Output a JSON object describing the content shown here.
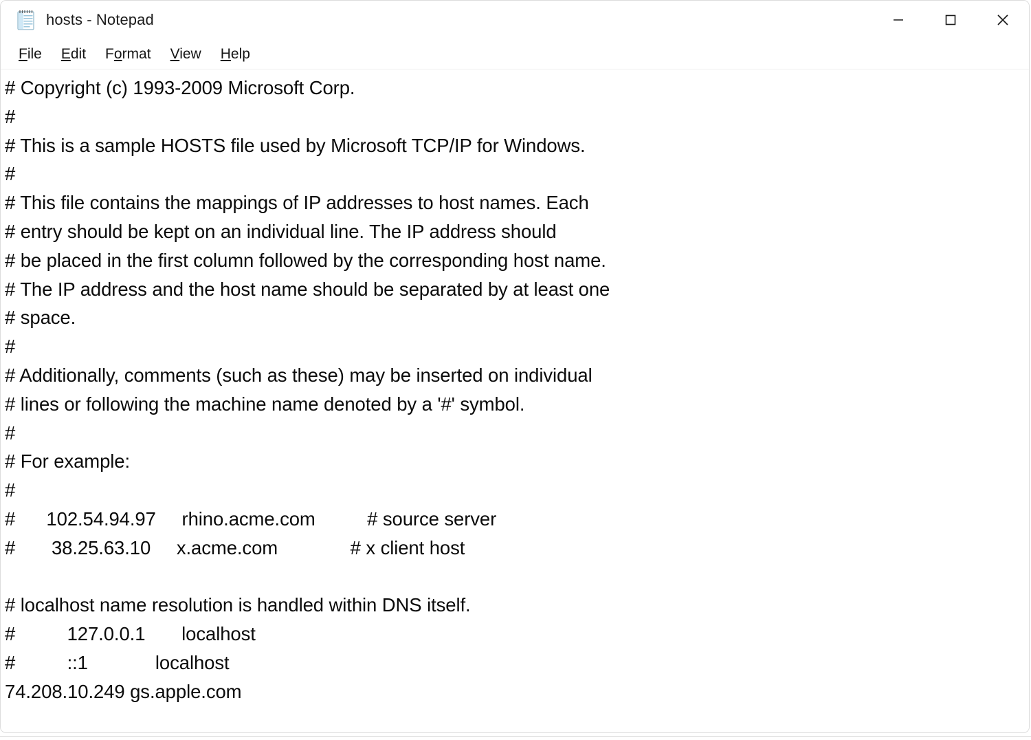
{
  "window": {
    "title": "hosts - Notepad",
    "icon": "notepad-icon",
    "controls": {
      "minimize": "minimize-icon",
      "maximize": "maximize-icon",
      "close": "close-icon"
    }
  },
  "menubar": {
    "items": [
      {
        "label": "File",
        "access_before": "",
        "access_key": "F",
        "access_after": "ile"
      },
      {
        "label": "Edit",
        "access_before": "",
        "access_key": "E",
        "access_after": "dit"
      },
      {
        "label": "Format",
        "access_before": "F",
        "access_key": "o",
        "access_after": "rmat"
      },
      {
        "label": "View",
        "access_before": "",
        "access_key": "V",
        "access_after": "iew"
      },
      {
        "label": "Help",
        "access_before": "",
        "access_key": "H",
        "access_after": "elp"
      }
    ]
  },
  "editor": {
    "filename": "hosts",
    "content": "# Copyright (c) 1993-2009 Microsoft Corp.\n#\n# This is a sample HOSTS file used by Microsoft TCP/IP for Windows.\n#\n# This file contains the mappings of IP addresses to host names. Each\n# entry should be kept on an individual line. The IP address should\n# be placed in the first column followed by the corresponding host name.\n# The IP address and the host name should be separated by at least one\n# space.\n#\n# Additionally, comments (such as these) may be inserted on individual\n# lines or following the machine name denoted by a '#' symbol.\n#\n# For example:\n#\n#      102.54.94.97     rhino.acme.com          # source server\n#       38.25.63.10     x.acme.com              # x client host\n\n# localhost name resolution is handled within DNS itself.\n#          127.0.0.1       localhost\n#          ::1             localhost\n74.208.10.249 gs.apple.com",
    "lines": [
      "# Copyright (c) 1993-2009 Microsoft Corp.",
      "#",
      "# This is a sample HOSTS file used by Microsoft TCP/IP for Windows.",
      "#",
      "# This file contains the mappings of IP addresses to host names. Each",
      "# entry should be kept on an individual line. The IP address should",
      "# be placed in the first column followed by the corresponding host name.",
      "# The IP address and the host name should be separated by at least one",
      "# space.",
      "#",
      "# Additionally, comments (such as these) may be inserted on individual",
      "# lines or following the machine name denoted by a '#' symbol.",
      "#",
      "# For example:",
      "#",
      "#      102.54.94.97     rhino.acme.com          # source server",
      "#       38.25.63.10     x.acme.com              # x client host",
      "",
      "# localhost name resolution is handled within DNS itself.",
      "#          127.0.0.1       localhost",
      "#          ::1             localhost",
      "74.208.10.249 gs.apple.com"
    ]
  },
  "colors": {
    "window_background": "#ffffff",
    "text": "#0b0b0b",
    "border": "#dcdcdc",
    "icon_blue": "#9fd4ef"
  }
}
